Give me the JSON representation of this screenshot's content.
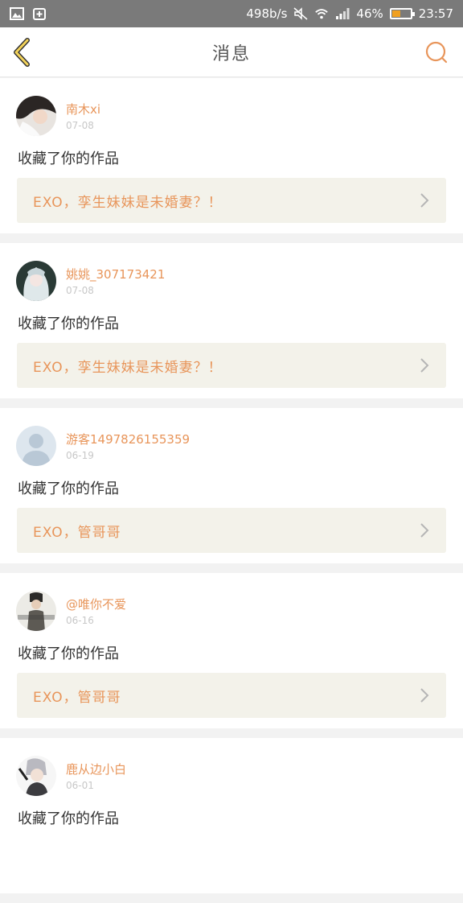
{
  "status_bar": {
    "net_speed": "498b/s",
    "battery_percent": "46%",
    "battery_level": 0.46,
    "time": "23:57",
    "icons": [
      "image-icon",
      "add-box-icon",
      "mute-icon",
      "wifi-icon",
      "signal-icon",
      "battery-icon"
    ]
  },
  "header": {
    "title": "消息",
    "back_icon": "back-chevron-icon",
    "search_icon": "search-icon"
  },
  "accent_color": "#e8955a",
  "messages": [
    {
      "name": "南木xi",
      "date": "07-08",
      "action": "收藏了你的作品",
      "work": "EXO，孪生妹妹是未婚妻？！"
    },
    {
      "name": "姚姚_307173421",
      "date": "07-08",
      "action": "收藏了你的作品",
      "work": "EXO，孪生妹妹是未婚妻？！"
    },
    {
      "name": "游客1497826155359",
      "date": "06-19",
      "action": "收藏了你的作品",
      "work": "EXO，管哥哥"
    },
    {
      "name": "@唯你不爱",
      "date": "06-16",
      "action": "收藏了你的作品",
      "work": "EXO，管哥哥"
    },
    {
      "name": "鹿从边小白",
      "date": "06-01",
      "action": "收藏了你的作品",
      "work": ""
    }
  ]
}
